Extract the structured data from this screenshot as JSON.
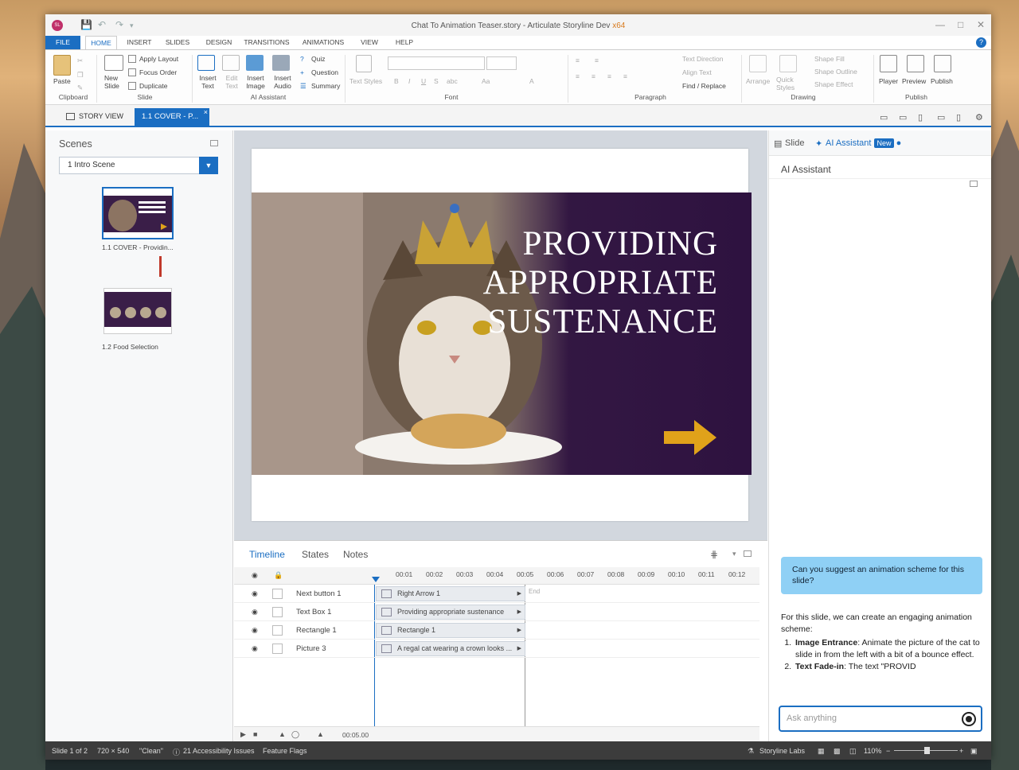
{
  "window": {
    "title": "Chat To Animation Teaser.story - Articulate Storyline Dev",
    "arch": "x64",
    "logo": "SL"
  },
  "ribbon_tabs": [
    "FILE",
    "HOME",
    "INSERT",
    "SLIDES",
    "DESIGN",
    "TRANSITIONS",
    "ANIMATIONS",
    "VIEW",
    "HELP"
  ],
  "ribbon": {
    "paste": "Paste",
    "clipboard": "Clipboard",
    "new_slide": "New Slide",
    "apply_layout": "Apply Layout",
    "focus_order": "Focus Order",
    "duplicate": "Duplicate",
    "slide_group": "Slide",
    "insert_text": "Insert Text",
    "edit_text": "Edit Text",
    "insert_image": "Insert Image",
    "insert_audio": "Insert Audio",
    "quiz": "Quiz",
    "question": "Question",
    "summary": "Summary",
    "ai_group": "AI Assistant",
    "text_styles": "Text Styles",
    "font_group": "Font",
    "text_direction": "Text Direction",
    "align_text": "Align Text",
    "find_replace": "Find / Replace",
    "paragraph_group": "Paragraph",
    "arrange": "Arrange",
    "quick_styles": "Quick Styles",
    "shape_fill": "Shape Fill",
    "shape_outline": "Shape Outline",
    "shape_effect": "Shape Effect",
    "drawing_group": "Drawing",
    "player": "Player",
    "preview": "Preview",
    "publish": "Publish",
    "publish_group": "Publish"
  },
  "viewbar": {
    "story_view": "STORY VIEW",
    "slide_tab": "1.1 COVER - P..."
  },
  "scenes": {
    "title": "Scenes",
    "selected_scene": "1 Intro Scene",
    "slides": [
      {
        "label": "1.1 COVER - Providin..."
      },
      {
        "label": "1.2 Food Selection"
      }
    ]
  },
  "slide": {
    "headline_lines": [
      "PROVIDING",
      "APPROPRIATE",
      "SUSTENANCE"
    ]
  },
  "timeline": {
    "tabs": [
      "Timeline",
      "States",
      "Notes"
    ],
    "ticks": [
      "00:01",
      "00:02",
      "00:03",
      "00:04",
      "00:05",
      "00:06",
      "00:07",
      "00:08",
      "00:09",
      "00:10",
      "00:11",
      "00:12"
    ],
    "end_label": "End",
    "rows": [
      {
        "name": "Next button 1",
        "object": "Right Arrow 1"
      },
      {
        "name": "Text Box 1",
        "object": "Providing appropriate sustenance"
      },
      {
        "name": "Rectangle 1",
        "object": "Rectangle 1"
      },
      {
        "name": "Picture 3",
        "object": "A regal cat wearing a crown looks ..."
      }
    ],
    "duration": "00:05.00"
  },
  "right_panel": {
    "tab_slide": "Slide",
    "tab_ai": "AI Assistant",
    "new_badge": "New",
    "heading": "AI Assistant",
    "user_message": "Can you suggest an animation scheme for this slide?",
    "reply_intro": "For this slide, we can create an engaging animation scheme:",
    "reply_items": [
      {
        "bold": "Image Entrance",
        "text": ": Animate the picture of the cat to slide in from the left with a bit of a bounce effect."
      },
      {
        "bold": "Text Fade-in",
        "text": ": The text \"PROVID"
      }
    ],
    "input_placeholder": "Ask anything"
  },
  "status": {
    "slide_of": "Slide 1 of 2",
    "dimensions": "720 × 540",
    "theme": "\"Clean\"",
    "accessibility": "21 Accessibility Issues",
    "feature_flags": "Feature Flags",
    "labs": "Storyline Labs",
    "zoom": "110%"
  },
  "colors": {
    "accent": "#1b6ec2",
    "arrow": "#e0a21a",
    "slide_purple": "#2e1240",
    "bubble": "#8fd0f5"
  }
}
